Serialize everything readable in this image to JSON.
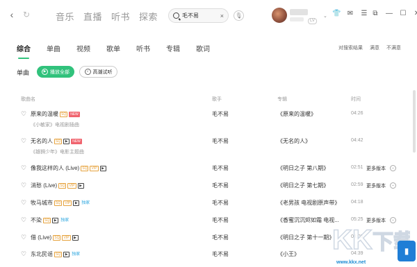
{
  "topbar": {
    "nav": [
      "音乐",
      "直播",
      "听书",
      "探索"
    ],
    "search_value": "毛不易",
    "vip_label": "LV"
  },
  "tabs": [
    "综合",
    "单曲",
    "视频",
    "歌单",
    "听书",
    "专辑",
    "歌词"
  ],
  "feedback": {
    "prompt": "对搜索结果",
    "satisfied": "满意",
    "unsatisfied": "不满意"
  },
  "section": {
    "title": "单曲",
    "play_all": "播放全部",
    "hifi_trial": "高潮试听"
  },
  "table": {
    "headers": {
      "song": "歌曲名",
      "singer": "歌手",
      "album": "专辑",
      "time": "时间"
    },
    "rows": [
      {
        "title": "原来的温暖",
        "tags": [
          "sq",
          "new"
        ],
        "subtitle": "《小敏家》电视剧插曲",
        "singer": "毛不易",
        "album": "《原来的温暖》",
        "duration": "04:26",
        "more": ""
      },
      {
        "title": "无名的人",
        "tags": [
          "sq",
          "mv",
          "new"
        ],
        "subtitle": "《雄狮少年》电影主题曲",
        "singer": "毛不易",
        "album": "《无名的人》",
        "duration": "04:42",
        "more": ""
      },
      {
        "title": "像我这样的人 (Live)",
        "tags": [
          "sq",
          "vip",
          "mv"
        ],
        "subtitle": "",
        "singer": "毛不易",
        "album": "《明日之子 第八期》",
        "duration": "02:51",
        "more": "更多版本"
      },
      {
        "title": "消愁 (Live)",
        "tags": [
          "sq",
          "vip",
          "mv"
        ],
        "subtitle": "",
        "singer": "毛不易",
        "album": "《明日之子 第七期》",
        "duration": "02:59",
        "more": "更多版本"
      },
      {
        "title": "牧马城市",
        "tags": [
          "sq",
          "vip",
          "mv",
          "exclusive"
        ],
        "subtitle": "",
        "singer": "毛不易",
        "album": "《老男孩 电视剧原声带》",
        "duration": "04:18",
        "more": ""
      },
      {
        "title": "不染",
        "tags": [
          "sq",
          "mv",
          "exclusive"
        ],
        "subtitle": "",
        "singer": "毛不易",
        "album": "《香蜜沉沉烬如霜 电视...",
        "duration": "05:25",
        "more": "更多版本"
      },
      {
        "title": "借 (Live)",
        "tags": [
          "sq",
          "vip",
          "mv"
        ],
        "subtitle": "",
        "singer": "毛不易",
        "album": "《明日之子 第十一期》",
        "duration": "04:05",
        "more": ""
      },
      {
        "title": "东北民谣",
        "tags": [
          "sq",
          "mv",
          "exclusive"
        ],
        "subtitle": "",
        "singer": "毛不易",
        "album": "《小王》",
        "duration": "04:39",
        "more": ""
      }
    ]
  },
  "tag_labels": {
    "sq": "SQ",
    "new": "NEW",
    "vip": "VIP",
    "mv": "▶",
    "exclusive": "独家"
  },
  "watermark": {
    "text": "www.kkx.net",
    "logo": "KK下载"
  },
  "colors": {
    "accent": "#31c27c",
    "new_tag": "#f0646e",
    "sq_tag": "#e6a23c",
    "exclusive": "#31a8e0"
  }
}
